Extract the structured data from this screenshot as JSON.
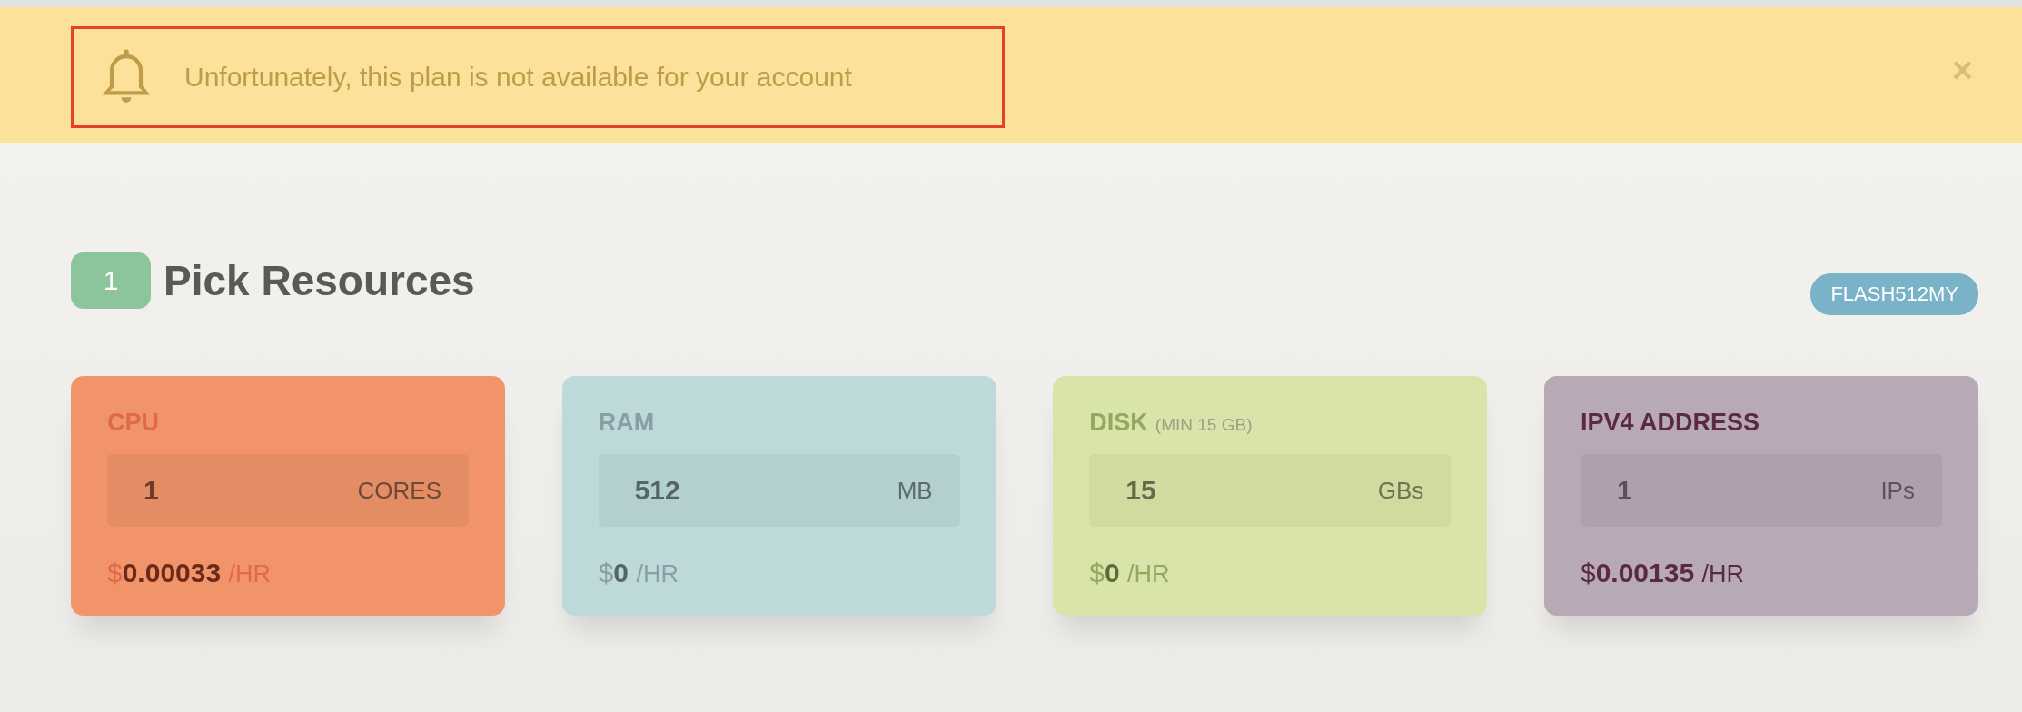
{
  "alert": {
    "message": "Unfortunately, this plan is not available for your account",
    "highlighted": true,
    "close": "×"
  },
  "section": {
    "step": "1",
    "title": "Pick Resources",
    "promo_code": "FLASH512MY"
  },
  "resources": [
    {
      "kind": "cpu",
      "color": "#f19469",
      "label": "CPU",
      "value": "1",
      "unit": "CORES",
      "price": {
        "currency": "$",
        "amount": "0.00033",
        "unit": "/HR"
      }
    },
    {
      "kind": "ram",
      "color": "#bed9da",
      "label": "RAM",
      "value": "512",
      "unit": "MB",
      "price": {
        "currency": "$",
        "amount": "0",
        "unit": "/HR"
      }
    },
    {
      "kind": "disk",
      "color": "#d9e4aa",
      "label": "DISK",
      "note": "(MIN 15 GB)",
      "value": "15",
      "unit": "GBs",
      "price": {
        "currency": "$",
        "amount": "0",
        "unit": "/HR"
      }
    },
    {
      "kind": "ip",
      "color": "#b8a9b7",
      "label": "IPV4 ADDRESS",
      "value": "1",
      "unit": "IPs",
      "price": {
        "currency": "$",
        "amount": "0.00135",
        "unit": "/HR"
      }
    }
  ]
}
